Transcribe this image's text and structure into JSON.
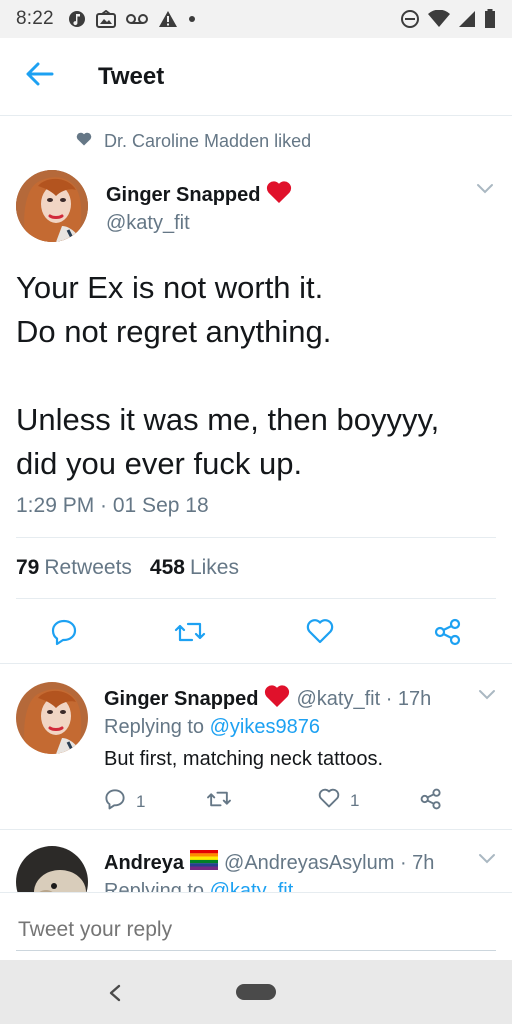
{
  "status_bar": {
    "time": "8:22",
    "left_icons": [
      "music-note-icon",
      "image-icon",
      "voicemail-icon",
      "warning-icon",
      "dot-icon"
    ],
    "right_icons": [
      "do-not-disturb-icon",
      "wifi-icon",
      "signal-icon",
      "battery-icon"
    ]
  },
  "header": {
    "title": "Tweet"
  },
  "liked_by": "Dr. Caroline Madden liked",
  "main_tweet": {
    "name": "Ginger Snapped",
    "handle": "@katy_fit",
    "lines": [
      "Your Ex is not worth it.",
      "Do not regret anything.",
      "",
      "Unless it was me, then boyyyy,",
      "did you ever fuck up."
    ],
    "timestamp": "1:29 PM · 01 Sep 18",
    "retweets_count": "79",
    "retweets_label": "Retweets",
    "likes_count": "458",
    "likes_label": "Likes"
  },
  "reply_tweet": {
    "name": "Ginger Snapped",
    "handle_time": "@katy_fit · 17h",
    "replying_prefix": "Replying to",
    "replying_to": "@yikes9876",
    "text": "But first, matching neck tattoos.",
    "reply_count": "1",
    "like_count": "1"
  },
  "third_tweet": {
    "name": "Andreya",
    "handle_time": "@AndreyasAsylum · 7h",
    "replying_prefix": "Replying to",
    "replying_to": "@katy_fit"
  },
  "composer": {
    "placeholder": "Tweet your reply"
  },
  "colors": {
    "accent": "#1da1f2",
    "heart": "#e0245e",
    "muted": "#657786"
  }
}
